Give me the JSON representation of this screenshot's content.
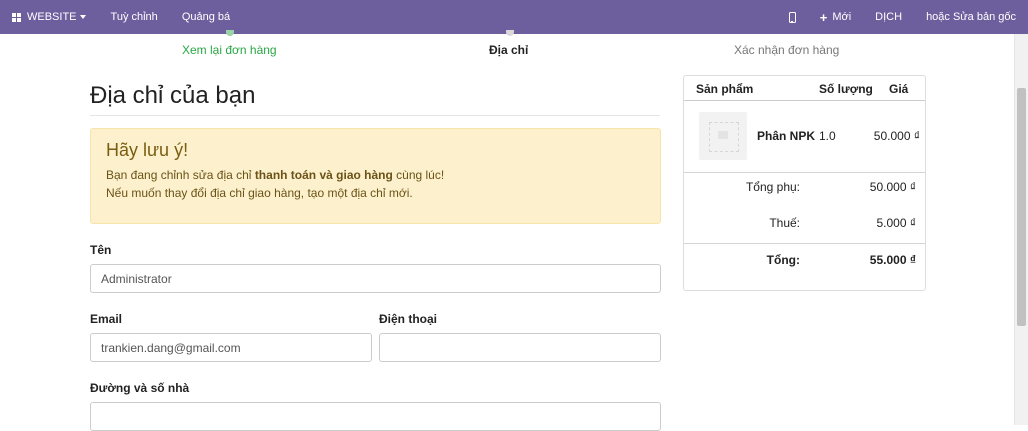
{
  "topbar": {
    "website_label": "WEBSITE",
    "customize_label": "Tuỳ chỉnh",
    "promote_label": "Quảng bá",
    "new_label": "Mới",
    "translate_label": "DỊCH",
    "edit_master_label": "hoặc Sửa bản gốc",
    "color": "#6d5f9e"
  },
  "steps": [
    {
      "label": "Xem lại đơn hàng",
      "state": "done"
    },
    {
      "label": "Địa chỉ",
      "state": "current"
    },
    {
      "label": "Xác nhận đơn hàng",
      "state": "todo"
    }
  ],
  "page": {
    "title": "Địa chỉ của bạn"
  },
  "alert": {
    "heading": "Hãy lưu ý!",
    "line1_prefix": "Bạn đang chỉnh sửa địa chỉ ",
    "line1_bold": "thanh toán và giao hàng",
    "line1_suffix": " cùng lúc!",
    "line2": "Nếu muốn thay đổi địa chỉ giao hàng, tạo một địa chỉ mới."
  },
  "form": {
    "name_label": "Tên",
    "name_value": "Administrator",
    "email_label": "Email",
    "email_value": "trankien.dang@gmail.com",
    "phone_label": "Điện thoại",
    "phone_value": "",
    "street_label": "Đường và số nhà",
    "street_value": ""
  },
  "summary": {
    "col_product": "Sản phẩm",
    "col_qty": "Số lượng",
    "col_price": "Giá",
    "items": [
      {
        "name": "Phân NPK",
        "qty": "1.0",
        "price": "50.000 ₫"
      }
    ],
    "subtotal_label": "Tổng phụ:",
    "subtotal_value": "50.000 ₫",
    "tax_label": "Thuế:",
    "tax_value": "5.000 ₫",
    "total_label": "Tổng:",
    "total_value": "55.000 ₫"
  }
}
